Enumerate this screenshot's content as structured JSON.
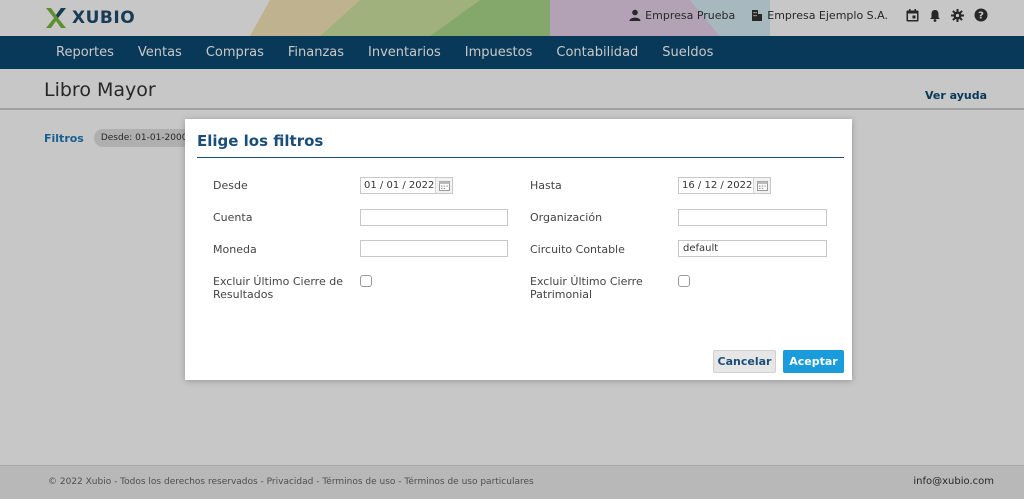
{
  "header": {
    "brand": "XUBIO",
    "company_label": "Empresa Prueba",
    "org_label": "Empresa Ejemplo S.A."
  },
  "nav": {
    "items": [
      "Reportes",
      "Ventas",
      "Compras",
      "Finanzas",
      "Inventarios",
      "Impuestos",
      "Contabilidad",
      "Sueldos"
    ]
  },
  "page": {
    "title": "Libro Mayor",
    "help_link": "Ver ayuda"
  },
  "filters": {
    "label": "Filtros",
    "chip": "Desde:  01-01-2000"
  },
  "modal": {
    "title": "Elige los filtros",
    "fields": {
      "desde_label": "Desde",
      "desde_value": "01 / 01 /  2022",
      "hasta_label": "Hasta",
      "hasta_value": "16 / 12 /  2022",
      "cuenta_label": "Cuenta",
      "cuenta_value": "",
      "organizacion_label": "Organización",
      "organizacion_value": "",
      "moneda_label": "Moneda",
      "moneda_value": "",
      "circuito_label": "Circuito Contable",
      "circuito_value": "default",
      "excluir_resultados_label": "Excluir Último Cierre de Resultados",
      "excluir_patrimonial_label": "Excluir Último Cierre Patrimonial"
    },
    "cancel_label": "Cancelar",
    "accept_label": "Aceptar"
  },
  "footer": {
    "copyright": "© 2022 Xubio - Todos los derechos reservados - Privacidad - Términos de uso - Términos de uso particulares",
    "email": "info@xubio.com"
  },
  "colors": {
    "navbar": "#0b4a73",
    "accent": "#1a9bdc",
    "title": "#1a4e78"
  },
  "icons": [
    "person-icon",
    "building-icon",
    "calendar-icon",
    "bell-icon",
    "gear-icon",
    "help-icon",
    "calendar-picker-icon"
  ]
}
